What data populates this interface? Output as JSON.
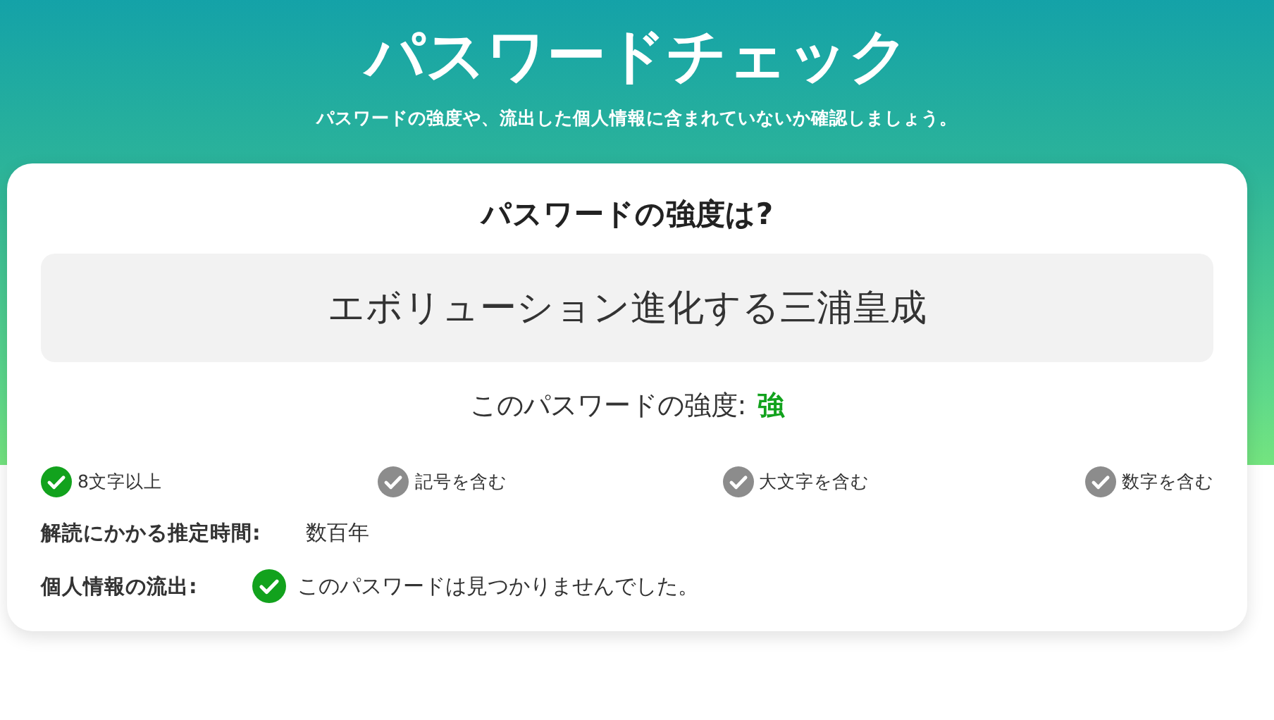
{
  "header": {
    "title": "パスワードチェック",
    "subtitle": "パスワードの強度や、流出した個人情報に含まれていないか確認しましょう。"
  },
  "card": {
    "heading": "パスワードの強度は?",
    "password": "エボリューション進化する三浦皇成",
    "strength": {
      "label": "このパスワードの強度:",
      "value": "強"
    },
    "criteria": [
      {
        "label": "8文字以上",
        "checked": true
      },
      {
        "label": "記号を含む",
        "checked": false
      },
      {
        "label": "大文字を含む",
        "checked": false
      },
      {
        "label": "数字を含む",
        "checked": false
      }
    ],
    "crack_time": {
      "label": "解読にかかる推定時間:",
      "value": "数百年"
    },
    "leak": {
      "label": "個人情報の流出:",
      "safe": true,
      "message": "このパスワードは見つかりませんでした。"
    }
  }
}
